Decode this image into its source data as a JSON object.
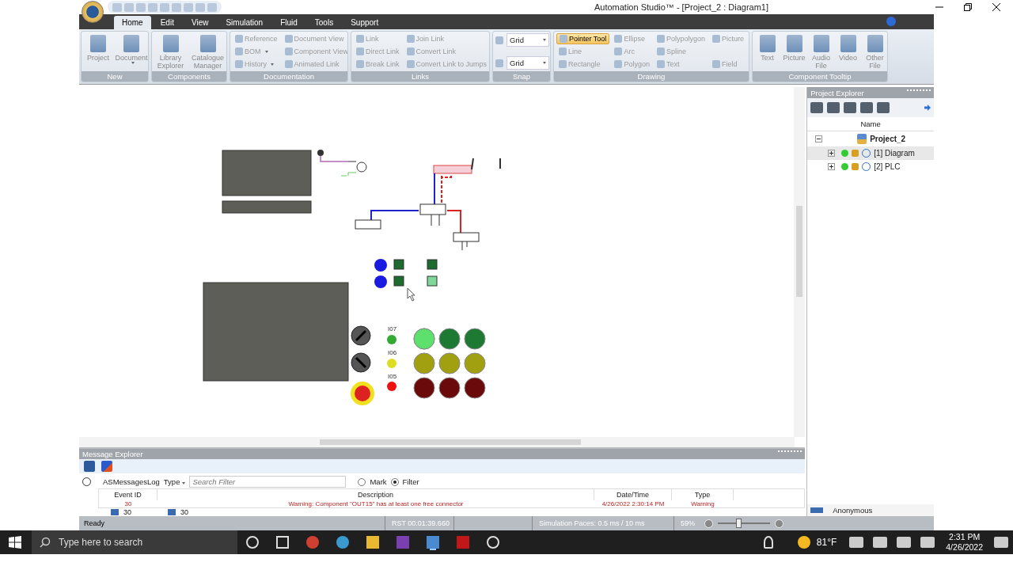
{
  "window": {
    "title": "Automation Studio™ - [Project_2 : Diagram1]"
  },
  "ribbon_tabs": [
    {
      "label": "Home",
      "selected": true
    },
    {
      "label": "Edit",
      "selected": false
    },
    {
      "label": "View",
      "selected": false
    },
    {
      "label": "Simulation",
      "selected": false
    },
    {
      "label": "Fluid",
      "selected": false
    },
    {
      "label": "Tools",
      "selected": false
    },
    {
      "label": "Support",
      "selected": false
    }
  ],
  "ribbon_groups": [
    {
      "label": "New",
      "columns": [
        [
          {
            "kind": "large",
            "label": "Project"
          }
        ],
        [
          {
            "kind": "large",
            "label": "Document",
            "dropdown": true
          }
        ]
      ]
    },
    {
      "label": "Components",
      "columns": [
        [
          {
            "kind": "large",
            "label": "Library Explorer"
          }
        ],
        [
          {
            "kind": "large",
            "label": "Catalogue Manager"
          }
        ]
      ]
    },
    {
      "label": "Documentation",
      "columns": [
        [
          {
            "kind": "small",
            "label": "Reference"
          },
          {
            "kind": "small",
            "label": "BOM",
            "dropdown": true
          },
          {
            "kind": "small",
            "label": "History",
            "dropdown": true
          }
        ],
        [
          {
            "kind": "small",
            "label": "Document View"
          },
          {
            "kind": "small",
            "label": "Component View"
          },
          {
            "kind": "small",
            "label": "Animated Link"
          }
        ]
      ]
    },
    {
      "label": "Links",
      "columns": [
        [
          {
            "kind": "small",
            "label": "Link"
          },
          {
            "kind": "small",
            "label": "Direct Link"
          },
          {
            "kind": "small",
            "label": "Break Link"
          }
        ],
        [
          {
            "kind": "small",
            "label": "Join Link"
          },
          {
            "kind": "small",
            "label": "Convert Link"
          },
          {
            "kind": "small",
            "label": "Convert Link to Jumps"
          }
        ]
      ]
    },
    {
      "label": "Snap",
      "columns": [
        [
          {
            "kind": "combo",
            "label": "Grid"
          },
          {
            "kind": "combo",
            "label": "Grid"
          }
        ]
      ]
    },
    {
      "label": "Drawing",
      "columns": [
        [
          {
            "kind": "small",
            "label": "Pointer Tool",
            "selected": true
          },
          {
            "kind": "small",
            "label": "Line",
            "selected": false
          },
          {
            "kind": "small",
            "label": "Rectangle",
            "selected": false
          }
        ],
        [
          {
            "kind": "small",
            "label": "Ellipse",
            "selected": false
          },
          {
            "kind": "small",
            "label": "Arc",
            "selected": false
          },
          {
            "kind": "small",
            "label": "Polygon",
            "selected": false
          }
        ],
        [
          {
            "kind": "small",
            "label": "Polypolygon",
            "selected": false
          },
          {
            "kind": "small",
            "label": "Spline",
            "selected": false
          },
          {
            "kind": "small",
            "label": "Text",
            "selected": false
          }
        ],
        [
          {
            "kind": "small",
            "label": "Picture",
            "selected": false
          },
          {
            "kind": "small",
            "label": "Field",
            "selected": false
          }
        ]
      ]
    },
    {
      "label": "Component Tooltip",
      "columns": [
        [
          {
            "kind": "large",
            "label": "Text"
          }
        ],
        [
          {
            "kind": "large",
            "label": "Picture"
          }
        ],
        [
          {
            "kind": "large",
            "label": "Audio File"
          }
        ],
        [
          {
            "kind": "large",
            "label": "Video"
          }
        ],
        [
          {
            "kind": "large",
            "label": "Other File"
          }
        ]
      ]
    }
  ],
  "diagram": {
    "light_labels": [
      "I07",
      "I06",
      "I05"
    ],
    "selector_switches": [
      {
        "on": true
      },
      {
        "on": false
      }
    ]
  },
  "message_explorer": {
    "title": "Message Explorer",
    "log": "ASMessagesLog",
    "type_filter": "Type",
    "search": {
      "placeholder": "Search Filter"
    },
    "radios": [
      {
        "label": "Mark",
        "selected": false
      },
      {
        "label": "Filter",
        "selected": true
      }
    ],
    "columns": [
      "Event ID",
      "Description",
      "Date/Time",
      "Type"
    ],
    "rows": [
      [
        "30",
        "Warning: Component \"OUT15\" has at least one free connector",
        "4/26/2022 2:30:14 PM",
        "Warning"
      ]
    ],
    "counts": [
      "30",
      "30"
    ]
  },
  "project_explorer": {
    "title": "Project Explorer",
    "column": "Name",
    "tree": [
      {
        "label": "Project_2",
        "expanded": true,
        "selected": false,
        "children": [
          {
            "label": "[1] Diagram",
            "expanded": false,
            "selected": true
          },
          {
            "label": "[2] PLC",
            "expanded": false,
            "selected": false
          }
        ]
      }
    ],
    "user": "Anonymous"
  },
  "status_bar": {
    "state": "Ready",
    "timer": "RST 00:01:39.660",
    "paces": "Simulation Paces: 0.5 ms / 10 ms",
    "zoom": "59%",
    "zoom_level": {
      "level": 0.4
    }
  },
  "taskbar": {
    "search": {
      "placeholder": "Type here to search"
    },
    "temperature": "81°F",
    "time": "2:31 PM",
    "date": "4/26/2022"
  }
}
